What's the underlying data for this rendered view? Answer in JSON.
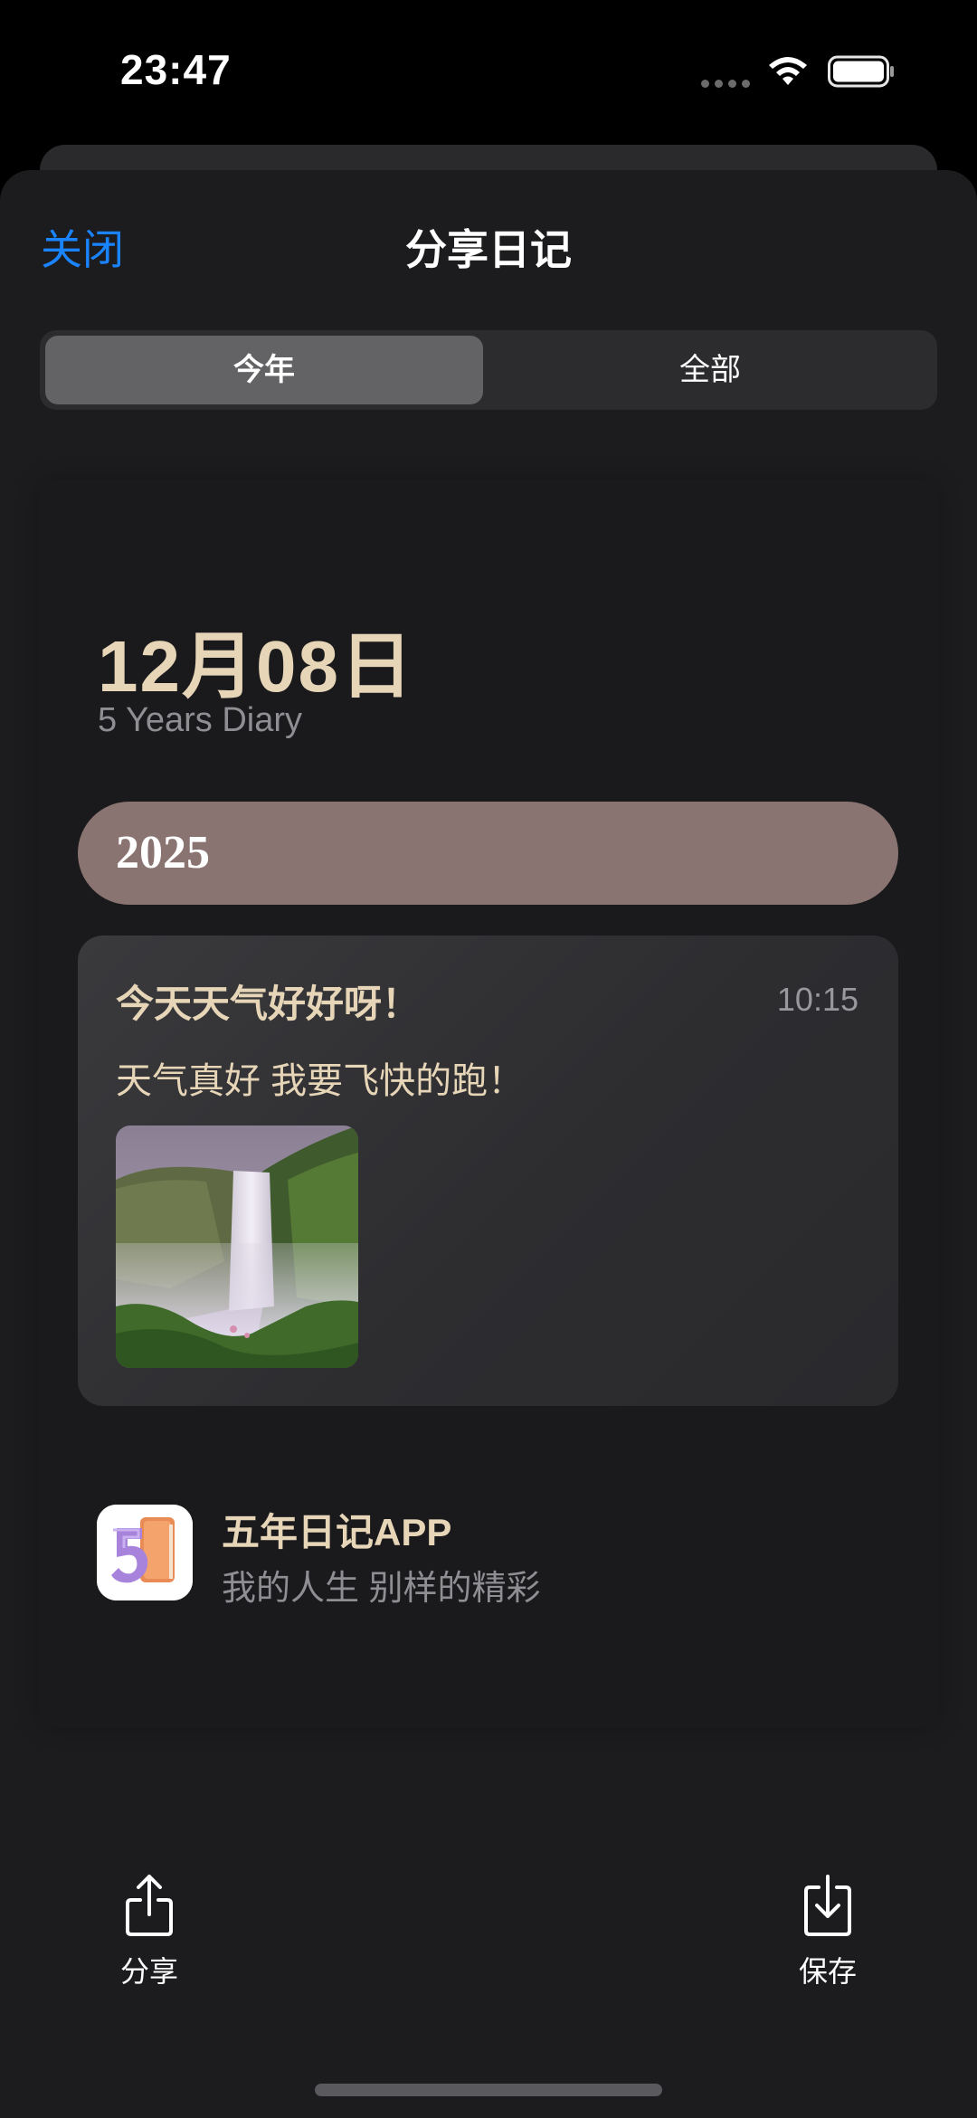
{
  "status_bar": {
    "time": "23:47"
  },
  "nav": {
    "close_label": "关闭",
    "title": "分享日记"
  },
  "segmented": {
    "options": [
      "今年",
      "全部"
    ],
    "selected": "今年"
  },
  "card": {
    "date": "12月08日",
    "subtitle": "5 Years Diary",
    "year": "2025",
    "entry": {
      "title": "今天天气好好呀！",
      "time": "10:15",
      "body": "天气真好 我要飞快的跑！",
      "photo": "waterfall-photo"
    },
    "app": {
      "name": "五年日记APP",
      "slogan": "我的人生 别样的精彩"
    }
  },
  "actions": {
    "share_label": "分享",
    "save_label": "保存"
  },
  "colors": {
    "accent": "#1a84ff",
    "gold_text": "#e7d5b8",
    "year_bar": "#8a7472",
    "sheet_bg": "#1c1c1e"
  },
  "icons": {
    "wifi": "wifi-icon",
    "battery": "battery-icon",
    "share": "share-icon",
    "save": "download-icon"
  }
}
